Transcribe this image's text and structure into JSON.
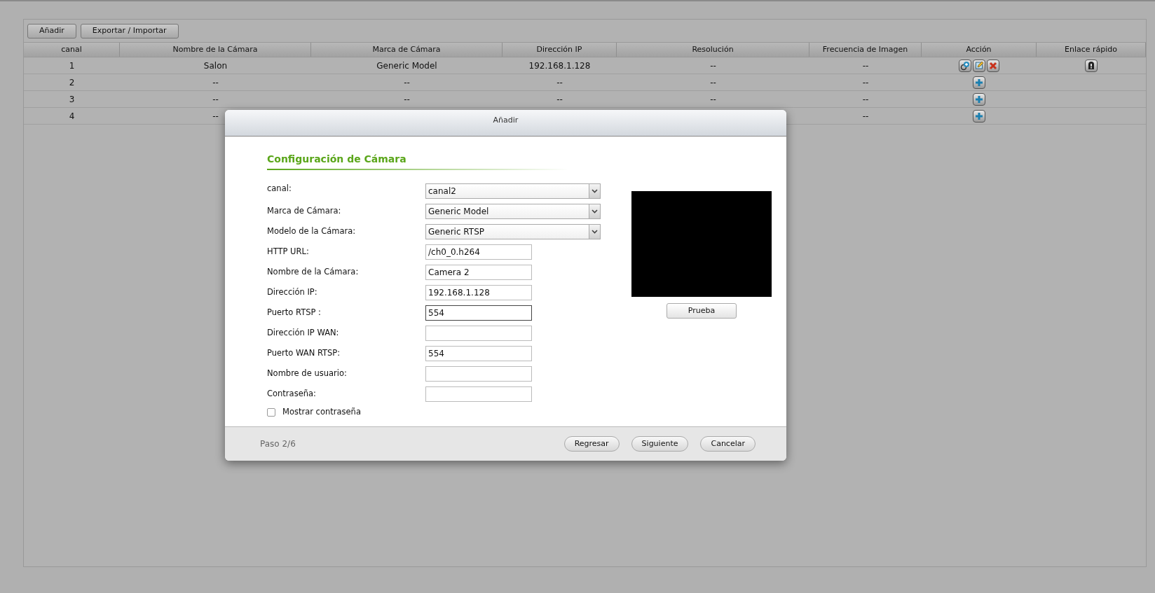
{
  "toolbar": {
    "buttons": [
      "Añadir",
      "Exportar / Importar"
    ]
  },
  "table": {
    "columns": [
      "canal",
      "Nombre de la Cámara",
      "Marca de Cámara",
      "Dirección IP",
      "Resolución",
      "Frecuencia de Imagen",
      "Acción",
      "Enlace rápido"
    ],
    "rows": [
      {
        "canal": "1",
        "name": "Salon",
        "brand": "Generic Model",
        "ip": "192.168.1.128",
        "resolution": "--",
        "frame_rate": "--",
        "actions": [
          {
            "kind": "connect"
          },
          {
            "kind": "edit"
          },
          {
            "kind": "delete"
          }
        ],
        "quick_link": true
      },
      {
        "canal": "2",
        "name": "--",
        "brand": "--",
        "ip": "--",
        "resolution": "--",
        "frame_rate": "--",
        "actions": [
          {
            "kind": "add"
          }
        ],
        "quick_link": false
      },
      {
        "canal": "3",
        "name": "--",
        "brand": "--",
        "ip": "--",
        "resolution": "--",
        "frame_rate": "--",
        "actions": [
          {
            "kind": "add"
          }
        ],
        "quick_link": false
      },
      {
        "canal": "4",
        "name": "--",
        "frame_rate": "--",
        "actions": [
          {
            "kind": "add"
          }
        ],
        "quick_link": false
      }
    ]
  },
  "dialog": {
    "title": "Añadir",
    "section_title": "Configuración de Cámara",
    "fields": [
      {
        "kind": "select",
        "label": "canal:",
        "value": "canal2"
      },
      {
        "kind": "select",
        "label": "Marca de Cámara:",
        "value": "Generic Model"
      },
      {
        "kind": "select",
        "label": "Modelo de la Cámara:",
        "value": "Generic RTSP"
      },
      {
        "kind": "text",
        "label": "HTTP URL:",
        "value": "/ch0_0.h264"
      },
      {
        "kind": "text",
        "label": "Nombre de la Cámara:",
        "value": "Camera 2"
      },
      {
        "kind": "text",
        "label": "Dirección IP:",
        "value": "192.168.1.128"
      },
      {
        "kind": "text",
        "label": "Puerto RTSP :",
        "value": "554",
        "focused": true
      },
      {
        "kind": "text",
        "label": "Dirección IP WAN:"
      },
      {
        "kind": "text",
        "label": "Puerto WAN RTSP:",
        "value": "554"
      },
      {
        "kind": "text",
        "label": "Nombre de usuario:"
      },
      {
        "kind": "text",
        "label": "Contraseña:"
      }
    ],
    "show_password": {
      "label": "Mostrar contraseña",
      "checked": false
    },
    "test_button": "Prueba",
    "step": "Paso 2/6",
    "buttons": [
      "Regresar",
      "Siguiente",
      "Cancelar"
    ]
  }
}
